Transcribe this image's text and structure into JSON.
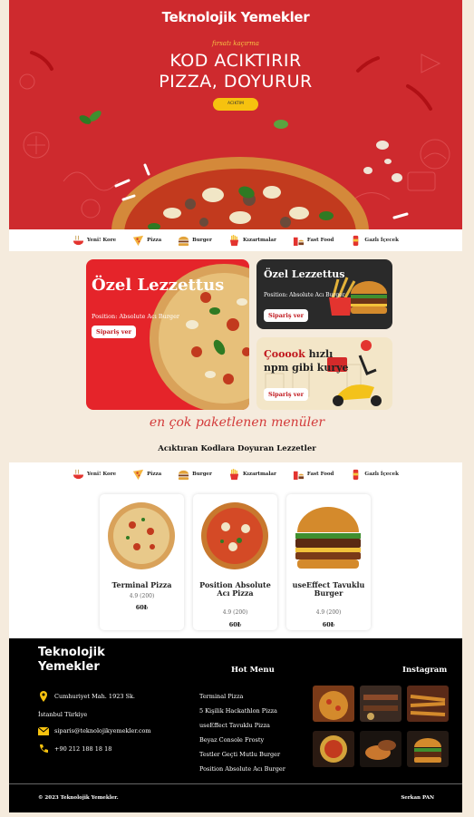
{
  "hero": {
    "logo": "Teknolojik Yemekler",
    "tagline": "fırsatı kaçırma",
    "headline_line1": "KOD ACIKTIRIR",
    "headline_line2": "PIZZA, DOYURUR",
    "cta": "ACIKTIM"
  },
  "categories": [
    {
      "label": "Yeni! Kore",
      "icon": "ramen-bowl-icon"
    },
    {
      "label": "Pizza",
      "icon": "pizza-slice-icon"
    },
    {
      "label": "Burger",
      "icon": "burger-icon"
    },
    {
      "label": "Kızartmalar",
      "icon": "fries-icon"
    },
    {
      "label": "Fast Food",
      "icon": "fast-food-icon"
    },
    {
      "label": "Gazlı İçecek",
      "icon": "soda-can-icon"
    }
  ],
  "categories2": [
    {
      "label": "Yeni! Kore",
      "icon": "ramen-bowl-icon"
    },
    {
      "label": "Pizza",
      "icon": "pizza-slice-icon"
    },
    {
      "label": "Burger",
      "icon": "burger-icon"
    },
    {
      "label": "Kızartmalar",
      "icon": "fries-icon"
    },
    {
      "label": "Fast Food",
      "icon": "fast-food-icon"
    },
    {
      "label": "Gazlı İçecek",
      "icon": "soda-can-icon"
    }
  ],
  "promos": {
    "big": {
      "title": "Özel Lezzettus",
      "subtitle": "Position: Absolute Acı Burger",
      "button": "Sipariş ver"
    },
    "dark": {
      "title": "Özel Lezzettus",
      "subtitle": "Position: Absolute Acı Burger",
      "button": "Sipariş ver"
    },
    "light": {
      "title_red": "Çooook",
      "title_rest": " hızlı",
      "title_line2": "npm gibi kurye",
      "button": "Sipariş ver"
    }
  },
  "section": {
    "script_title": "en çok paketlenen menüler",
    "subtitle": "Acıktıran Kodlara Doyuran Lezzetler"
  },
  "products": [
    {
      "name": "Terminal Pizza",
      "rating": "4.9",
      "reviews": "(200)",
      "price": "60₺"
    },
    {
      "name": "Position Absolute Acı Pizza",
      "rating": "4.9",
      "reviews": "(200)",
      "price": "60₺"
    },
    {
      "name": "useEffect Tavuklu Burger",
      "rating": "4.9",
      "reviews": "(200)",
      "price": "60₺"
    }
  ],
  "footer": {
    "logo_line1": "Teknolojik",
    "logo_line2": "Yemekler",
    "address_line1": "Cumhuriyet Mah. 1923 Sk.",
    "address_line2": "İstanbul Türkiye",
    "email": "siparis@teknolojikyemekler.com",
    "phone": "+90 212 188 18 18",
    "menu_heading": "Hot Menu",
    "menu_items": [
      "Terminal Pizza",
      "5 Kişilik Hackathlon Pizza",
      "useEffect Tavuklu Pizza",
      "Beyaz Console Frosty",
      "Testler Geçti Mutlu Burger",
      "Position Absolute Acı Burger"
    ],
    "instagram_heading": "Instagram",
    "copyright": "© 2023 Teknolojik Yemekler.",
    "author": "Serkan PAN"
  },
  "colors": {
    "brand_red": "#ce2a2e",
    "accent_yellow": "#f6c20f",
    "cream": "#f5ebdd"
  }
}
